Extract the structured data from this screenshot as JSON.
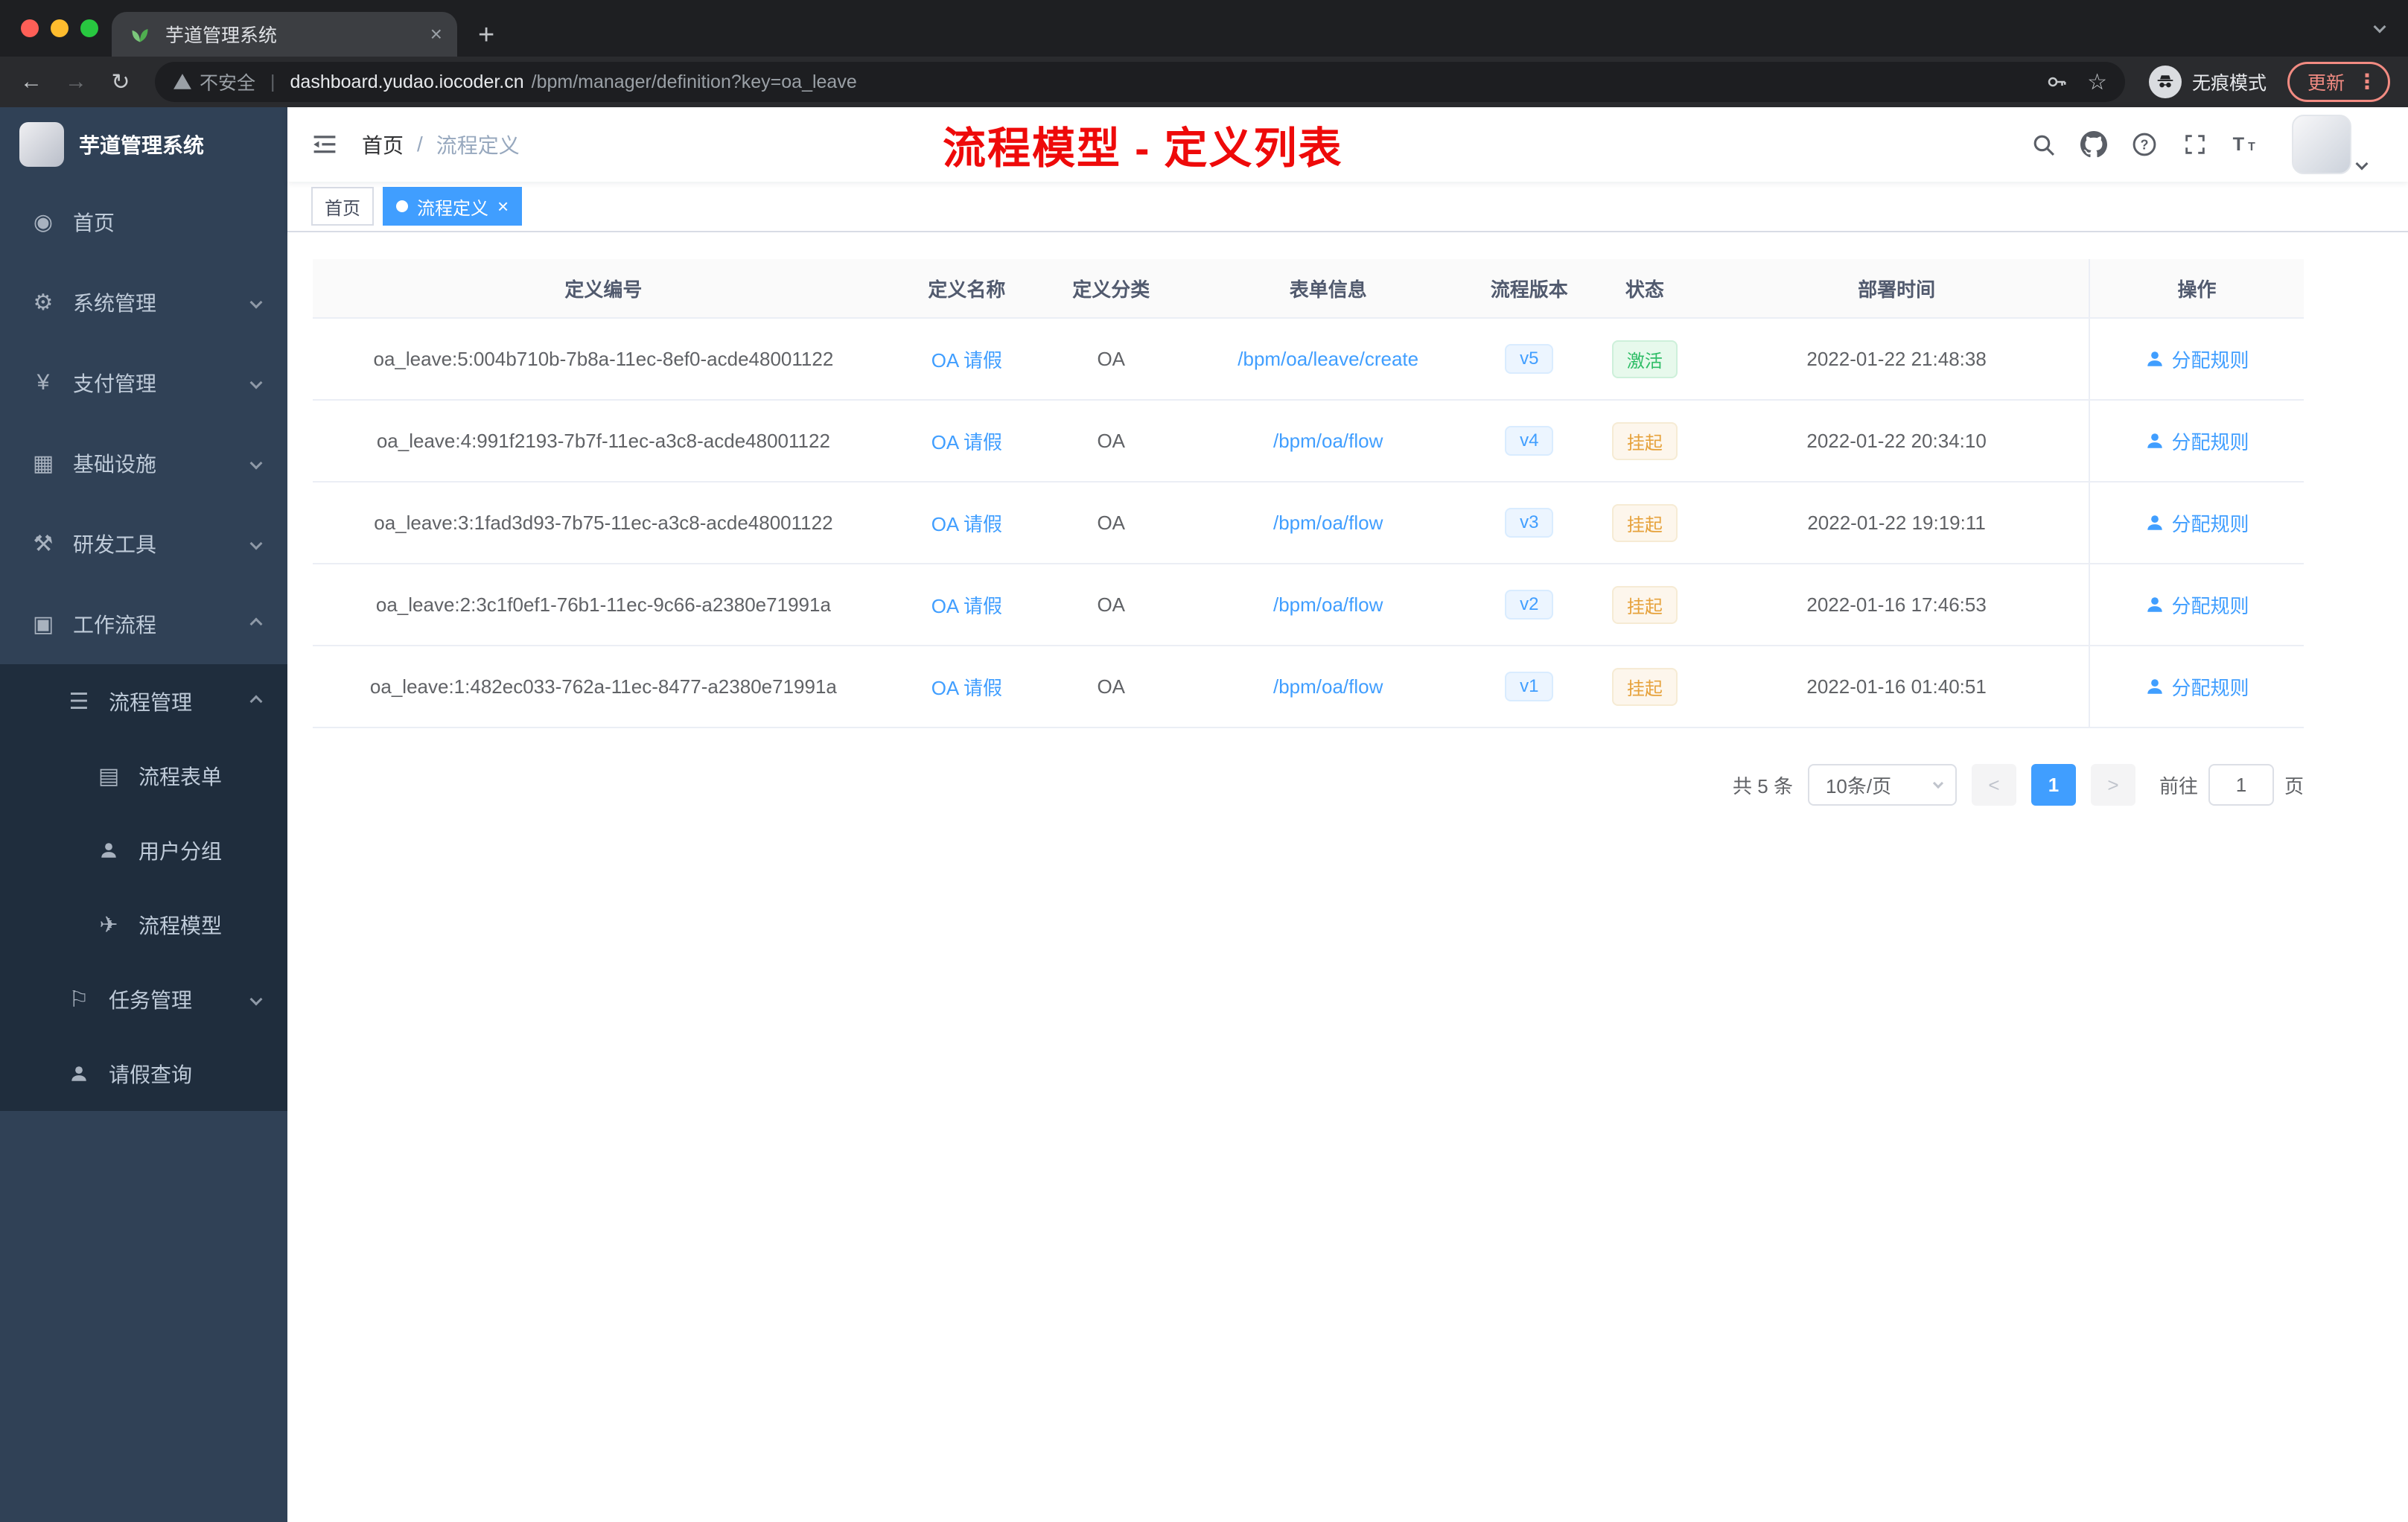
{
  "browser": {
    "tab": {
      "title": "芋道管理系统"
    },
    "new_tab_label": "+",
    "address": {
      "security": "不安全",
      "separator": "|",
      "domain": "dashboard.yudao.iocoder.cn",
      "path": "/bpm/manager/definition?key=oa_leave"
    },
    "incognito_label": "无痕模式",
    "update_label": "更新"
  },
  "sidebar": {
    "title": "芋道管理系统",
    "top_items": [
      {
        "label": "首页"
      },
      {
        "label": "系统管理"
      },
      {
        "label": "支付管理"
      },
      {
        "label": "基础设施"
      },
      {
        "label": "研发工具"
      },
      {
        "label": "工作流程"
      }
    ],
    "workflow": {
      "process_mgmt": {
        "label": "流程管理"
      },
      "process_children": [
        {
          "label": "流程表单"
        },
        {
          "label": "用户分组"
        },
        {
          "label": "流程模型"
        }
      ],
      "task_mgmt": {
        "label": "任务管理"
      },
      "leave_query": {
        "label": "请假查询"
      }
    }
  },
  "header": {
    "breadcrumb_home": "首页",
    "breadcrumb_separator": "/",
    "breadcrumb_current": "流程定义",
    "annotation": "流程模型 - 定义列表"
  },
  "tags": {
    "home": "首页",
    "current": "流程定义",
    "close": "×"
  },
  "table": {
    "columns": {
      "id": "定义编号",
      "name": "定义名称",
      "category": "定义分类",
      "form": "表单信息",
      "version": "流程版本",
      "status": "状态",
      "time": "部署时间",
      "action": "操作"
    },
    "rows": [
      {
        "id": "oa_leave:5:004b710b-7b8a-11ec-8ef0-acde48001122",
        "name": "OA 请假",
        "category": "OA",
        "form": "/bpm/oa/leave/create",
        "version": "v5",
        "status": "激活",
        "time": "2022-01-22 21:48:38",
        "action": "分配规则"
      },
      {
        "id": "oa_leave:4:991f2193-7b7f-11ec-a3c8-acde48001122",
        "name": "OA 请假",
        "category": "OA",
        "form": "/bpm/oa/flow",
        "version": "v4",
        "status": "挂起",
        "time": "2022-01-22 20:34:10",
        "action": "分配规则"
      },
      {
        "id": "oa_leave:3:1fad3d93-7b75-11ec-a3c8-acde48001122",
        "name": "OA 请假",
        "category": "OA",
        "form": "/bpm/oa/flow",
        "version": "v3",
        "status": "挂起",
        "time": "2022-01-22 19:19:11",
        "action": "分配规则"
      },
      {
        "id": "oa_leave:2:3c1f0ef1-76b1-11ec-9c66-a2380e71991a",
        "name": "OA 请假",
        "category": "OA",
        "form": "/bpm/oa/flow",
        "version": "v2",
        "status": "挂起",
        "time": "2022-01-16 17:46:53",
        "action": "分配规则"
      },
      {
        "id": "oa_leave:1:482ec033-762a-11ec-8477-a2380e71991a",
        "name": "OA 请假",
        "category": "OA",
        "form": "/bpm/oa/flow",
        "version": "v1",
        "status": "挂起",
        "time": "2022-01-16 01:40:51",
        "action": "分配规则"
      }
    ]
  },
  "pagination": {
    "total": "共 5 条",
    "page_size": "10条/页",
    "prev": "<",
    "next": ">",
    "current_page": "1",
    "goto_label": "前往",
    "goto_value": "1",
    "goto_unit": "页"
  },
  "colors": {
    "accent": "#409eff",
    "status_active": "#2ebd66",
    "status_suspended": "#e6a23c",
    "annotation_red": "#ee0a0a",
    "sidebar_bg": "#304156",
    "submenu_bg": "#1f2d3d"
  }
}
